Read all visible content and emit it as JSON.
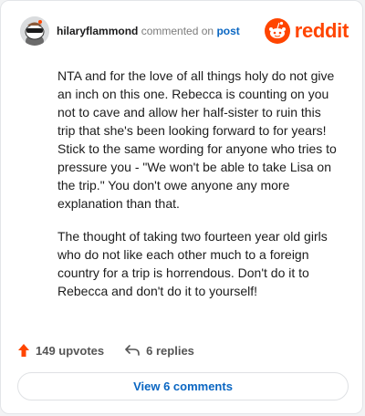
{
  "comment": {
    "username": "hilaryflammond",
    "action_text": "commented on",
    "post_link": "post",
    "brand": "reddit",
    "paragraphs": [
      "NTA and for the love of all things holy do not give an inch on this one. Rebecca is counting on you not to cave and allow her half-sister to ruin this trip that she's been looking forward to for years! Stick to the same wording for anyone who tries to pressure you - \"We won't be able to take Lisa on the trip.\" You don't owe anyone any more explanation than that.",
      "The thought of taking two fourteen year old girls who do not like each other much to a foreign country for a trip is horrendous. Don't do it to Rebecca and don't do it to yourself!"
    ],
    "upvotes": "149 upvotes",
    "replies": "6 replies",
    "view_comments": "View 6 comments"
  },
  "colors": {
    "brand": "#ff4500",
    "link": "#0a66c2",
    "upvote": "#ff4500"
  },
  "icons": {
    "avatar": "snoo-sunglasses-avatar",
    "brand": "reddit-snoo-icon",
    "upvote": "upvote-arrow-icon",
    "reply": "reply-arrow-icon"
  }
}
